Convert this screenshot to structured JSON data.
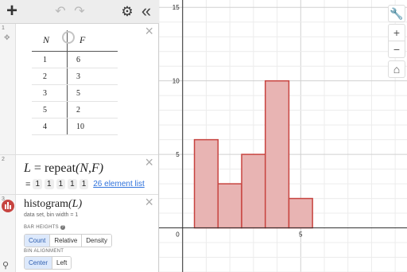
{
  "toolbar": {
    "add_icon": "plus-icon",
    "undo_icon": "undo-icon",
    "redo_icon": "redo-icon",
    "settings_icon": "gear-icon",
    "collapse_icon": "double-chevron-left-icon"
  },
  "expressions": [
    {
      "number": "1",
      "type": "table",
      "columns": [
        "N",
        "F"
      ],
      "rows": [
        [
          "1",
          "6"
        ],
        [
          "2",
          "3"
        ],
        [
          "3",
          "5"
        ],
        [
          "5",
          "2"
        ],
        [
          "4",
          "10"
        ]
      ]
    },
    {
      "number": "2",
      "lhs": "L",
      "eq": "=",
      "rhs_fn": "repeat",
      "rhs_args": "(N,F)",
      "list_prefix": "=",
      "list_values": [
        "1",
        "1",
        "1",
        "1",
        "1"
      ],
      "list_link": "26 element list"
    },
    {
      "number": "3",
      "title_fn": "histogram",
      "title_args": "(L)",
      "subtitle": "data set, bin width = 1",
      "bar_heights_label": "BAR HEIGHTS",
      "bar_heights_options": [
        "Count",
        "Relative",
        "Density"
      ],
      "bar_heights_selected": "Count",
      "bin_alignment_label": "BIN ALIGNMENT",
      "bin_alignment_options": [
        "Center",
        "Left"
      ],
      "bin_alignment_selected": "Center"
    }
  ],
  "right_tools": {
    "wrench_icon": "wrench-icon",
    "zoom_in_label": "+",
    "zoom_out_label": "−",
    "home_icon": "home-icon"
  },
  "graph": {
    "x_label_0": "0",
    "x_label_5": "5",
    "y_label_5": "5",
    "y_label_10": "10",
    "y_label_15": "15",
    "bar_color": "#c74440",
    "bar_fill": "#e8b4b3"
  },
  "chart_data": {
    "type": "bar",
    "title": "",
    "xlabel": "",
    "ylabel": "",
    "bins_center": [
      1,
      2,
      3,
      4,
      5
    ],
    "bin_width": 1,
    "values": [
      6,
      3,
      5,
      10,
      2
    ],
    "xlim": [
      -1,
      9.5
    ],
    "ylim": [
      -3,
      15.5
    ],
    "grid": true
  }
}
